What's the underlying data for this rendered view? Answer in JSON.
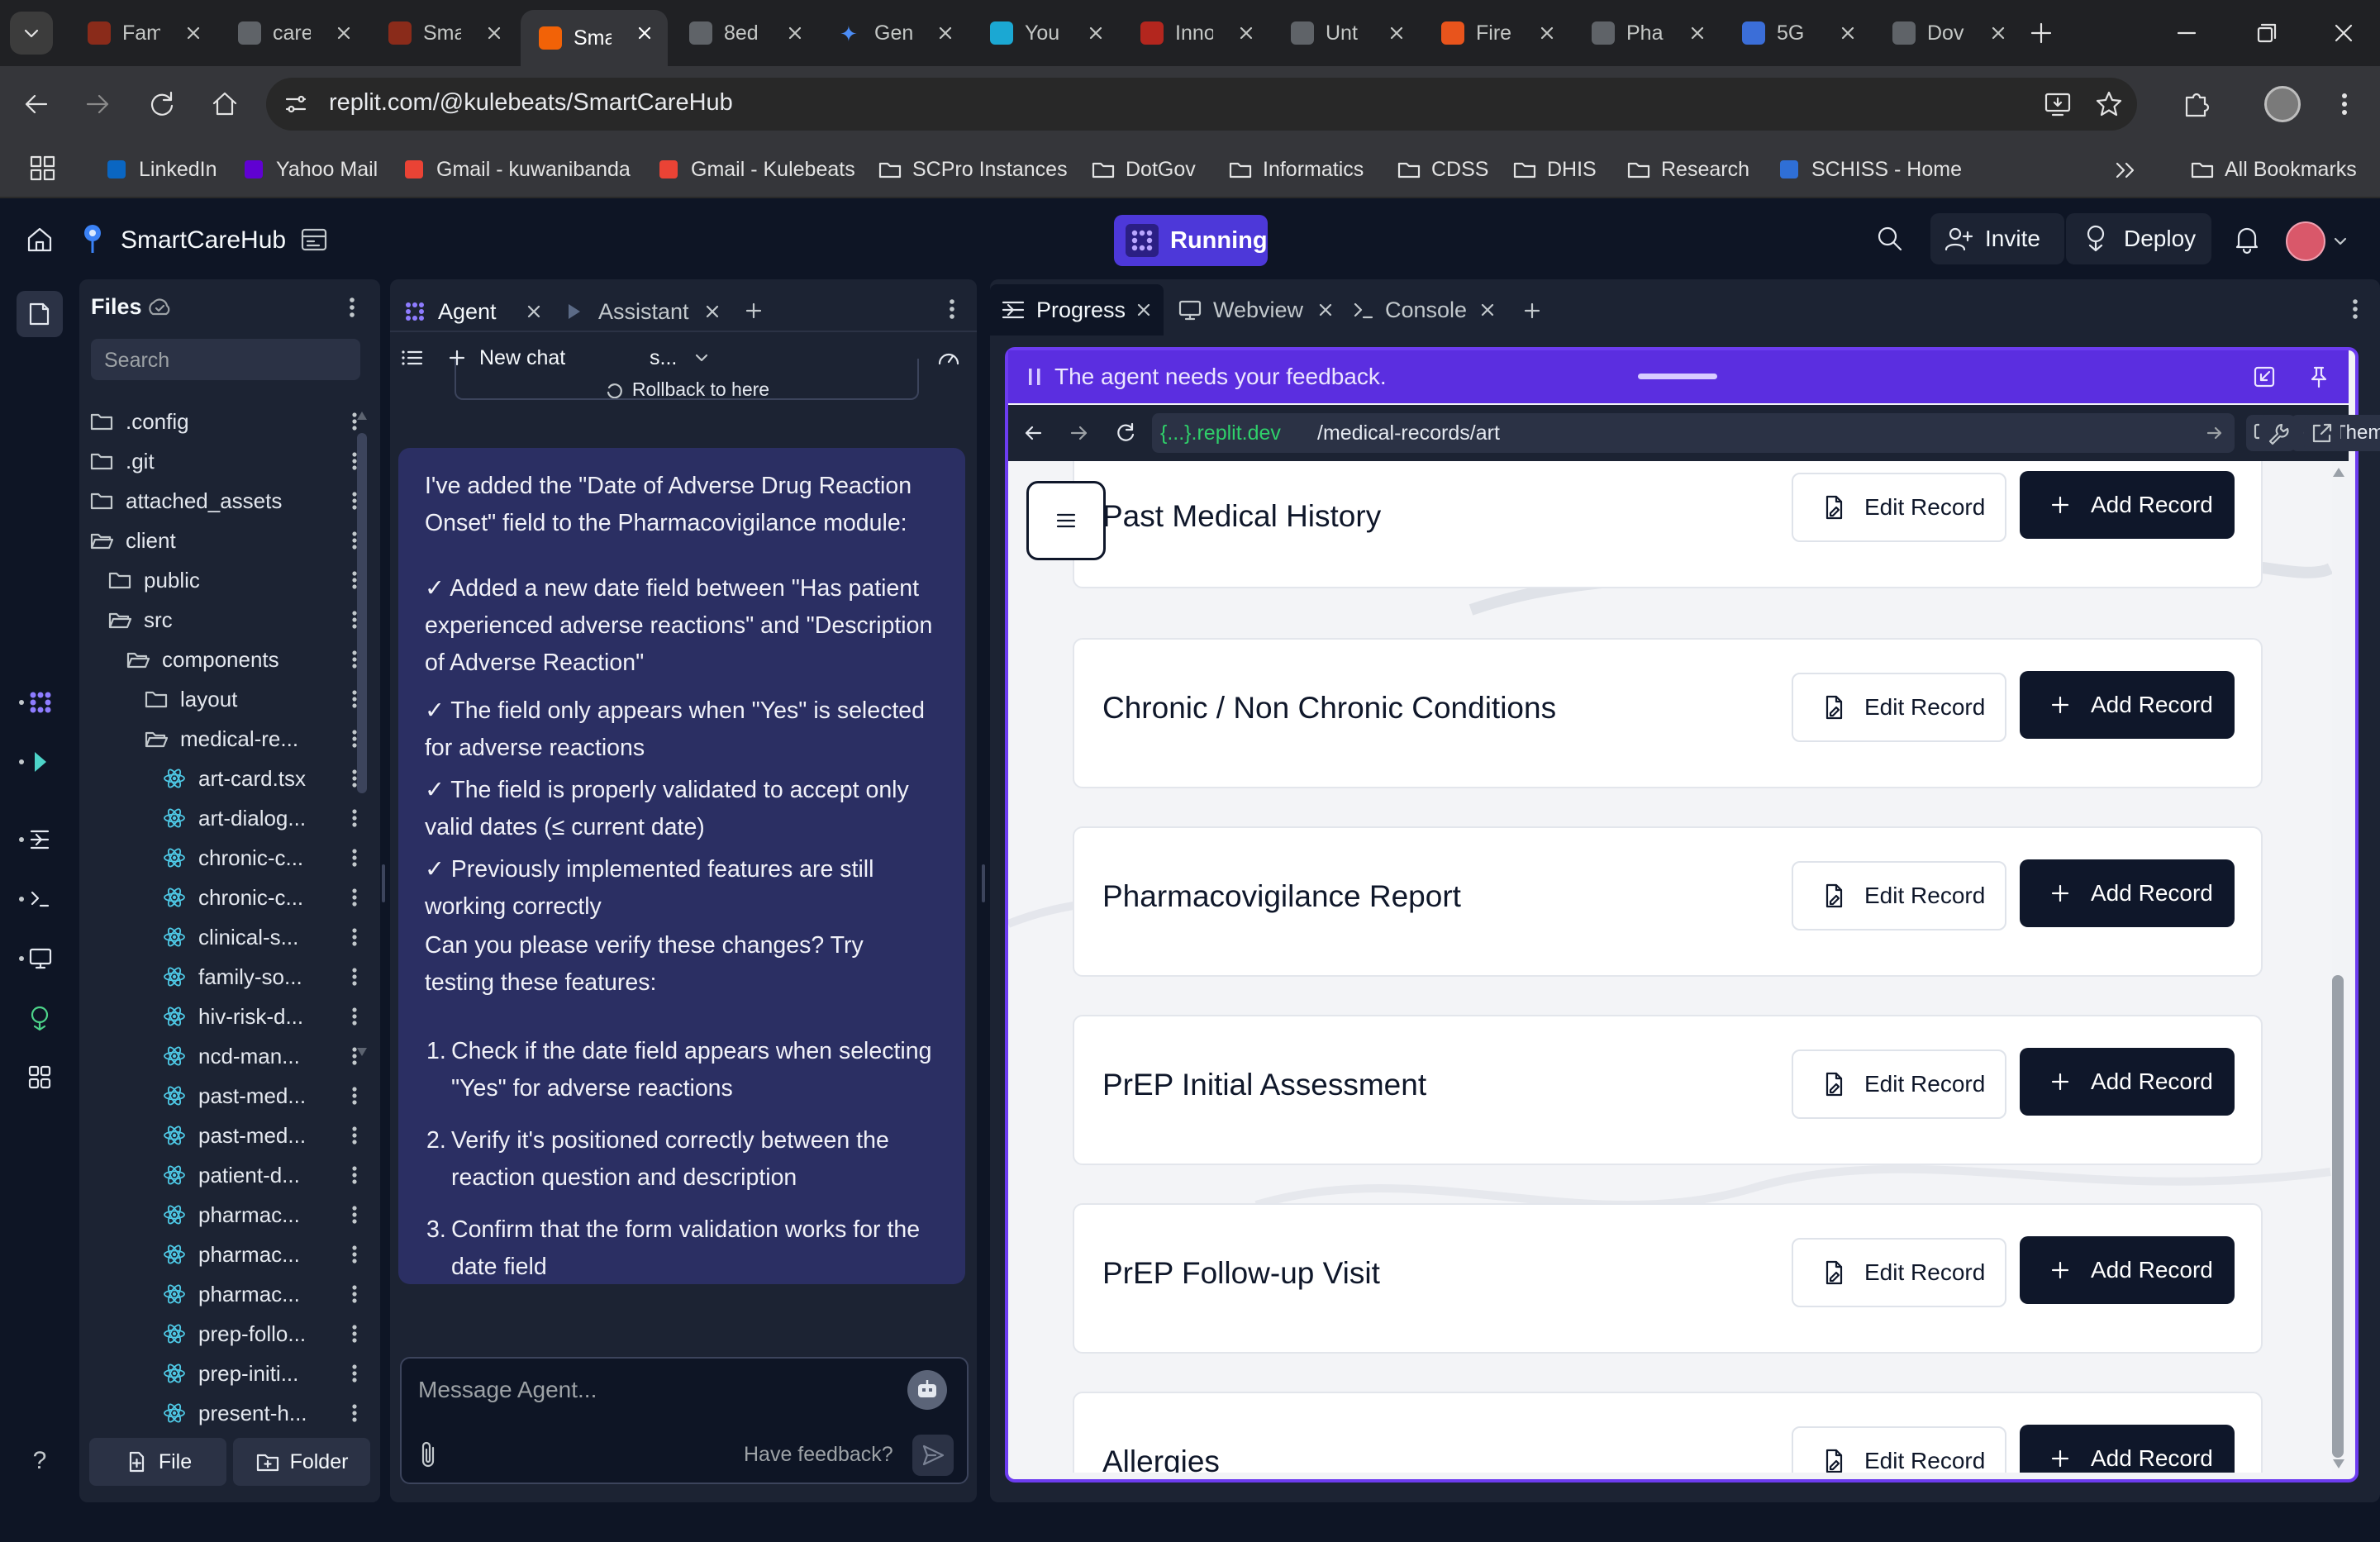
{
  "browser": {
    "tabs": [
      {
        "label": "Fam",
        "color": "#8a2b1a"
      },
      {
        "label": "care",
        "color": "#5f6368"
      },
      {
        "label": "Sma",
        "color": "#8a2b1a"
      },
      {
        "label": "Sma",
        "color": "#f26207",
        "active": true
      },
      {
        "label": "8ed",
        "color": "#5f6368"
      },
      {
        "label": "Gen",
        "color": "#4c8df6"
      },
      {
        "label": "You",
        "color": "#1ba8d3"
      },
      {
        "label": "Inno",
        "color": "#b3261e"
      },
      {
        "label": "Unt",
        "color": "#5f6368"
      },
      {
        "label": "Fire",
        "color": "#e8541c"
      },
      {
        "label": "Pha",
        "color": "#5f6368"
      },
      {
        "label": "5G",
        "color": "#3b6ed8"
      },
      {
        "label": "Dov",
        "color": "#5f6368"
      }
    ],
    "url": "replit.com/@kulebeats/SmartCareHub",
    "bookmarks": [
      {
        "label": "LinkedIn",
        "icon": "linkedin-icon"
      },
      {
        "label": "Yahoo Mail",
        "icon": "yahoo-icon"
      },
      {
        "label": "Gmail - kuwanibanda",
        "icon": "gmail-icon"
      },
      {
        "label": "Gmail - Kulebeats",
        "icon": "gmail-icon"
      },
      {
        "label": "SCPro Instances",
        "icon": "folder-icon"
      },
      {
        "label": "DotGov",
        "icon": "folder-icon"
      },
      {
        "label": "Informatics",
        "icon": "folder-icon"
      },
      {
        "label": "CDSS",
        "icon": "folder-icon"
      },
      {
        "label": "DHIS",
        "icon": "folder-icon"
      },
      {
        "label": "Research",
        "icon": "folder-icon"
      },
      {
        "label": "SCHISS - Home",
        "icon": "schiss-icon"
      }
    ],
    "all_bookmarks": "All Bookmarks"
  },
  "replit": {
    "project": "SmartCareHub",
    "running": "Running",
    "invite": "Invite",
    "deploy": "Deploy"
  },
  "files": {
    "title": "Files",
    "search_placeholder": "Search",
    "items": [
      {
        "name": ".config",
        "type": "folder",
        "depth": 0
      },
      {
        "name": ".git",
        "type": "folder",
        "depth": 0
      },
      {
        "name": "attached_assets",
        "type": "folder",
        "depth": 0
      },
      {
        "name": "client",
        "type": "folder-open",
        "depth": 0
      },
      {
        "name": "public",
        "type": "folder",
        "depth": 1
      },
      {
        "name": "src",
        "type": "folder-open",
        "depth": 1
      },
      {
        "name": "components",
        "type": "folder-open",
        "depth": 2
      },
      {
        "name": "layout",
        "type": "folder",
        "depth": 3
      },
      {
        "name": "medical-re...",
        "type": "folder-open",
        "depth": 3
      },
      {
        "name": "art-card.tsx",
        "type": "react",
        "depth": 4
      },
      {
        "name": "art-dialog...",
        "type": "react",
        "depth": 4
      },
      {
        "name": "chronic-c...",
        "type": "react",
        "depth": 4
      },
      {
        "name": "chronic-c...",
        "type": "react",
        "depth": 4
      },
      {
        "name": "clinical-s...",
        "type": "react",
        "depth": 4
      },
      {
        "name": "family-so...",
        "type": "react",
        "depth": 4
      },
      {
        "name": "hiv-risk-d...",
        "type": "react",
        "depth": 4
      },
      {
        "name": "ncd-man...",
        "type": "react",
        "depth": 4
      },
      {
        "name": "past-med...",
        "type": "react",
        "depth": 4
      },
      {
        "name": "past-med...",
        "type": "react",
        "depth": 4
      },
      {
        "name": "patient-d...",
        "type": "react",
        "depth": 4
      },
      {
        "name": "pharmac...",
        "type": "react",
        "depth": 4
      },
      {
        "name": "pharmac...",
        "type": "react",
        "depth": 4
      },
      {
        "name": "pharmac...",
        "type": "react",
        "depth": 4
      },
      {
        "name": "prep-follo...",
        "type": "react",
        "depth": 4
      },
      {
        "name": "prep-initi...",
        "type": "react",
        "depth": 4
      },
      {
        "name": "present-h...",
        "type": "react",
        "depth": 4
      }
    ],
    "new_file": "File",
    "new_folder": "Folder"
  },
  "agent": {
    "tab_agent": "Agent",
    "tab_assistant": "Assistant",
    "new_chat": "New chat",
    "model": "s...",
    "rollback": "Rollback to here",
    "message": {
      "intro": "I've added the \"Date of Adverse Drug Reaction Onset\" field to the Pharmacovigilance module:",
      "checks": [
        "✓ Added a new date field between \"Has patient experienced adverse reactions\" and \"Description of Adverse Reaction\"",
        "✓ The field only appears when \"Yes\" is selected for adverse reactions",
        "✓ The field is properly validated to accept only valid dates (≤ current date)",
        "✓ Previously implemented features are still working correctly"
      ],
      "question": "Can you please verify these changes? Try testing these features:",
      "steps": [
        "Check if the date field appears when selecting \"Yes\" for adverse reactions",
        "Verify it's positioned correctly between the reaction question and description",
        "Confirm that the form validation works for the date field"
      ]
    },
    "input_placeholder": "Message Agent...",
    "feedback": "Have feedback?"
  },
  "right_panel": {
    "tabs": [
      "Progress",
      "Webview",
      "Console"
    ],
    "banner": "The agent needs your feedback.",
    "host": "{...}.replit.dev",
    "path": "/medical-records/art",
    "theme": "Theme"
  },
  "records": {
    "edit_label": "Edit Record",
    "add_label": "Add Record",
    "cards": [
      "Past Medical History",
      "Chronic / Non Chronic Conditions",
      "Pharmacovigilance Report",
      "PrEP Initial Assessment",
      "PrEP Follow-up Visit",
      "Allergies"
    ]
  }
}
